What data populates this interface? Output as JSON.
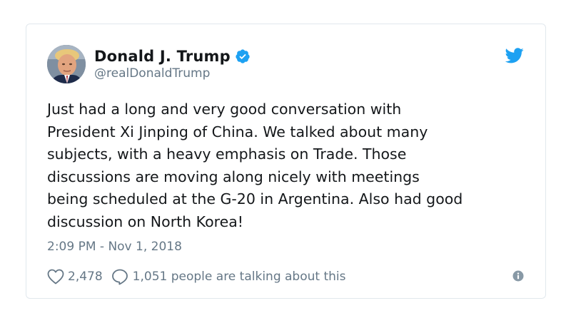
{
  "tweet": {
    "author": {
      "display_name": "Donald J. Trump",
      "handle": "@realDonaldTrump",
      "verified": true
    },
    "text_lines": [
      "Just had a long and very good conversation with",
      "President Xi Jinping of China. We talked about many",
      "subjects, with a heavy emphasis on Trade. Those",
      "discussions are moving along nicely with meetings",
      "being scheduled at the G-20 in Argentina. Also had good",
      "discussion on North Korea!"
    ],
    "timestamp": "2:09 PM - Nov 1, 2018",
    "likes": "2,478",
    "talking": "1,051 people are talking about this"
  },
  "colors": {
    "text_primary": "#14171a",
    "text_secondary": "#657786",
    "twitter_blue": "#1da1f2",
    "border": "#e1e8ed"
  },
  "icons": {
    "verified": "verified-badge-icon",
    "brand": "twitter-bird-icon",
    "like": "heart-icon",
    "reply": "speech-bubble-icon",
    "info": "info-icon"
  }
}
